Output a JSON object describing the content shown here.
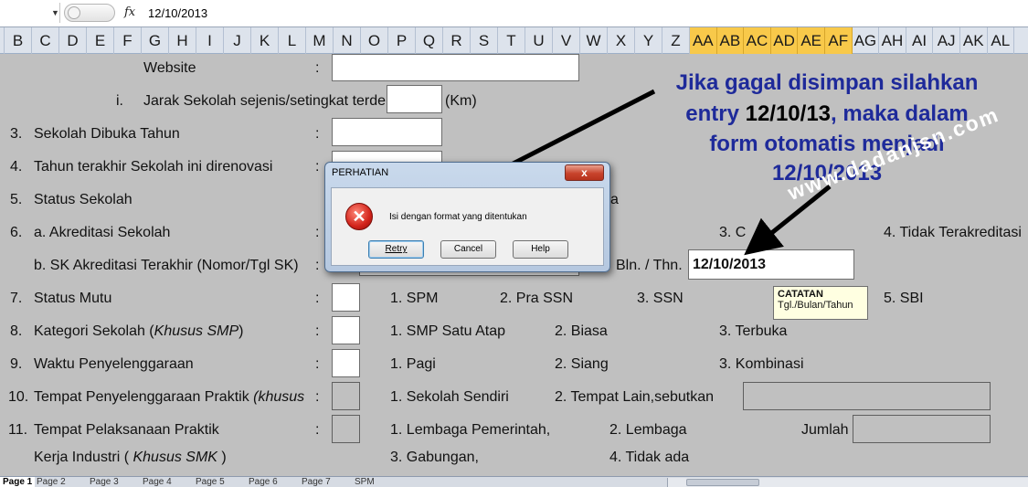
{
  "formula_bar": {
    "fx_label": "fx",
    "value": "12/10/2013"
  },
  "columns": [
    "B",
    "C",
    "D",
    "E",
    "F",
    "G",
    "H",
    "I",
    "J",
    "K",
    "L",
    "M",
    "N",
    "O",
    "P",
    "Q",
    "R",
    "S",
    "T",
    "U",
    "V",
    "W",
    "X",
    "Y",
    "Z",
    "AA",
    "AB",
    "AC",
    "AD",
    "AE",
    "AF",
    "AG",
    "AH",
    "AI",
    "AJ",
    "AK",
    "AL"
  ],
  "selected_columns": [
    "AA",
    "AB",
    "AC",
    "AD",
    "AE",
    "AF"
  ],
  "form": {
    "website_label": "Website",
    "jarak_num": "i.",
    "jarak_label": "Jarak Sekolah sejenis/setingkat terdek",
    "jarak_unit": "(Km)",
    "r3_num": "3.",
    "r3_label": "Sekolah Dibuka Tahun",
    "r4_num": "4.",
    "r4_label": "Tahun terakhir Sekolah ini direnovasi",
    "r5_num": "5.",
    "r5_label": "Status Sekolah",
    "r5_partial": "a",
    "r6_num": "6.",
    "r6_label": "a. Akreditasi Sekolah",
    "r6_opt3": "3. C",
    "r6_opt4": "4. Tidak Terakreditasi",
    "r6b_label": "b. SK Akreditasi Terakhir (Nomor/Tgl SK)",
    "bln_thn_label": "Bln. / Thn.",
    "bln_thn_value": "12/10/2013",
    "r7_num": "7.",
    "r7_label": "Status Mutu",
    "r7_opt1": "1. SPM",
    "r7_opt2": "2. Pra SSN",
    "r7_opt3": "3. SSN",
    "r7_opt5": "5. SBI",
    "r8_num": "8.",
    "r8_label_a": "Kategori Sekolah (",
    "r8_label_i": "Khusus SMP",
    "r8_label_b": ")",
    "r8_opt1": "1. SMP Satu Atap",
    "r8_opt2": "2. Biasa",
    "r8_opt3": "3. Terbuka",
    "r9_num": "9.",
    "r9_label": "Waktu Penyelenggaraan",
    "r9_opt1": "1. Pagi",
    "r9_opt2": "2. Siang",
    "r9_opt3": "3. Kombinasi",
    "r10_num": "10.",
    "r10_label_a": "Tempat Penyelenggaraan Praktik ",
    "r10_label_i": "(khusus",
    "r10_opt1": "1. Sekolah Sendiri",
    "r10_opt2": "2. Tempat Lain,sebutkan",
    "r11_num": "11.",
    "r11_label": "Tempat Pelaksanaan Praktik",
    "r11_opt1": "1. Lembaga Pemerintah,",
    "r11_opt2": "2. Lembaga",
    "r11_jumlah": "Jumlah",
    "r11b_label_a": "Kerja Industri ( ",
    "r11b_label_i": "Khusus SMK",
    "r11b_label_b": " )",
    "r11_opt3": "3. Gabungan,",
    "r11_opt4": "4. Tidak ada",
    "colon": ":"
  },
  "dialog": {
    "title": "PERHATIAN",
    "close": "x",
    "message": "Isi dengan format yang ditentukan",
    "retry": "Retry",
    "cancel": "Cancel",
    "help": "Help"
  },
  "tooltip": {
    "title": "CATATAN",
    "body": "Tgl./Bulan/Tahun"
  },
  "annotation": {
    "line1": "Jika gagal disimpan silahkan",
    "line2_a": "entry ",
    "line2_b": "12/10/13",
    "line2_c": ", maka dalam",
    "line3": "form otomatis menjadi",
    "line4": "12/10/2013",
    "watermark": "www.dadanjsn.com"
  },
  "tabs": [
    "Page 1",
    "Page 2",
    "Page 3",
    "Page 4",
    "Page 5",
    "Page 6",
    "Page 7",
    "SPM"
  ],
  "colors": {
    "sheet_bg": "#c0c0c0",
    "header_bg": "#dde3ec",
    "selected_header": "#f8c94a",
    "annotation_text": "#1e2a9a",
    "close_button": "#c8432c"
  }
}
